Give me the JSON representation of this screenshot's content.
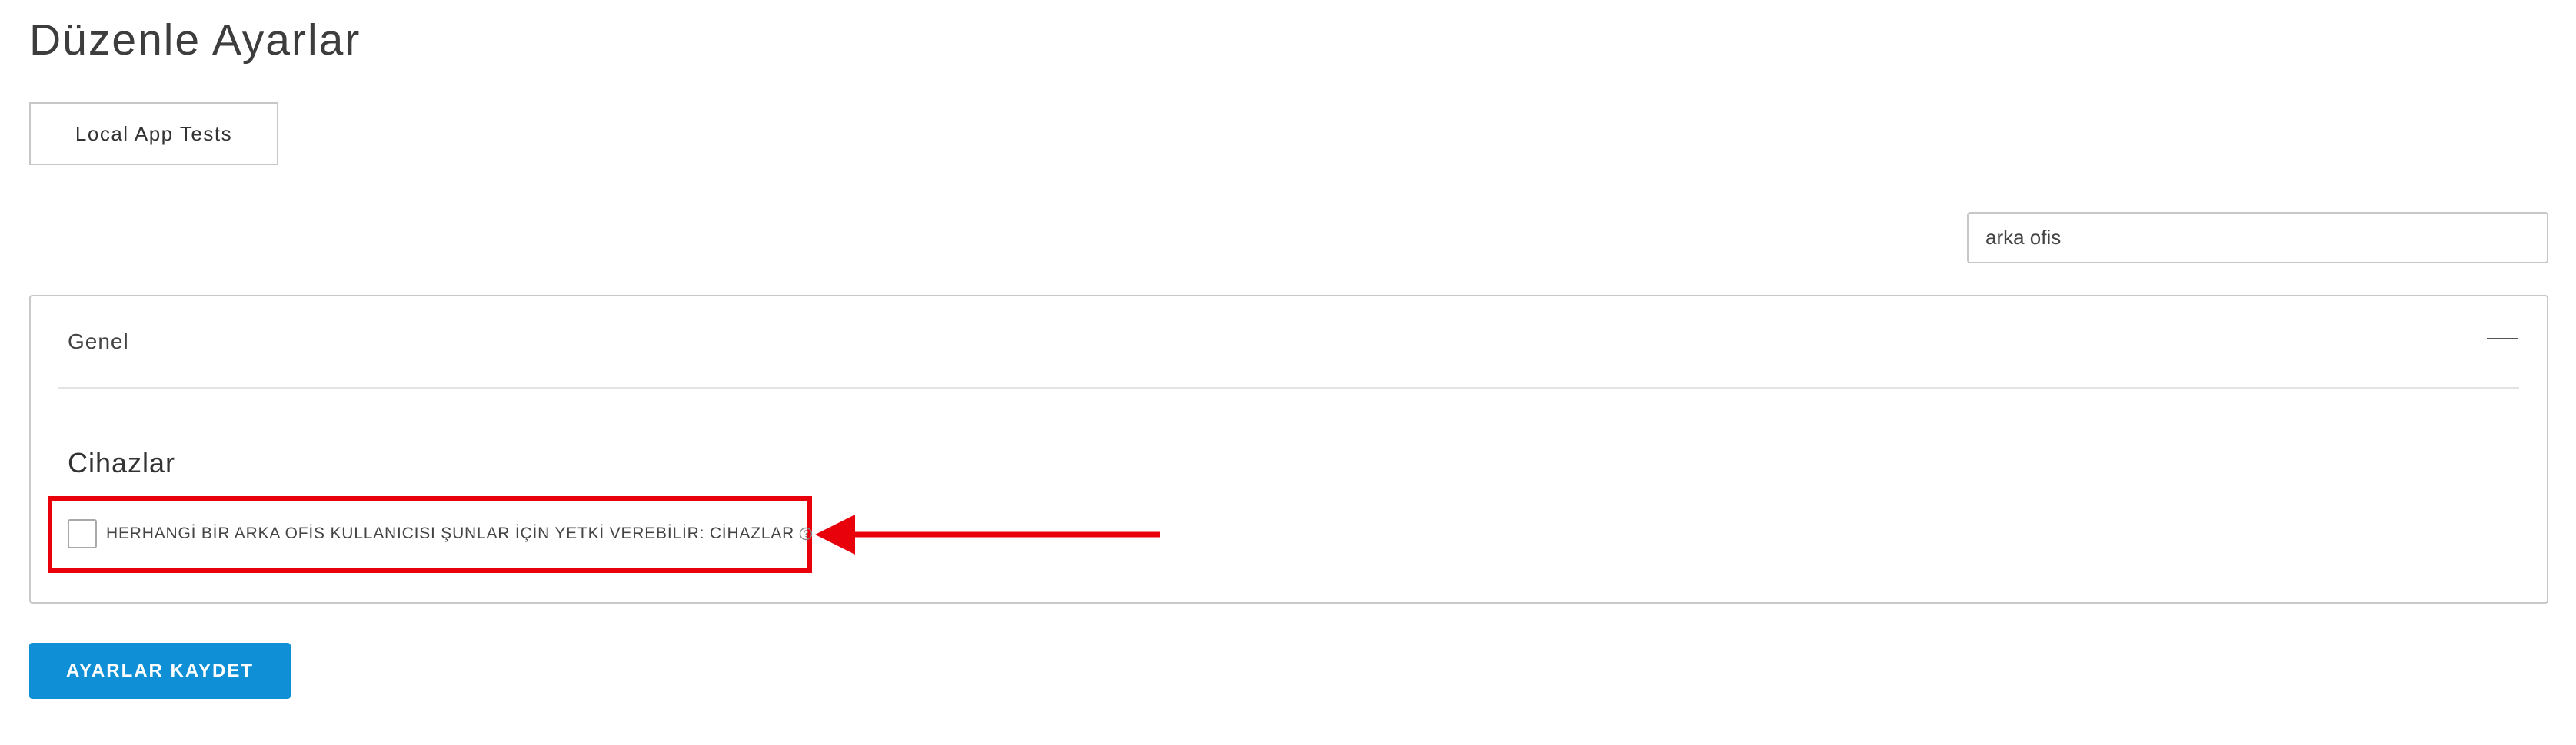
{
  "page": {
    "title": "Düzenle Ayarlar"
  },
  "app_tab": {
    "label": "Local App Tests"
  },
  "search": {
    "value": "arka ofis"
  },
  "panel": {
    "title": "Genel",
    "collapse_icon": "minus-icon",
    "section": {
      "heading": "Cihazlar",
      "settings": [
        {
          "label": "HERHANGİ BİR ARKA OFİS KULLANICISI ŞUNLAR İÇİN YETKİ VEREBİLİR: CİHAZLAR",
          "checked": false,
          "help_icon": "question-circle-icon"
        }
      ]
    }
  },
  "annotation": {
    "highlight_color": "#e8000b",
    "arrow_color": "#e8000b",
    "arrow_icon": "left-arrow-icon"
  },
  "footer": {
    "save_label": "AYARLAR KAYDET",
    "save_color": "#0e8fd6"
  }
}
